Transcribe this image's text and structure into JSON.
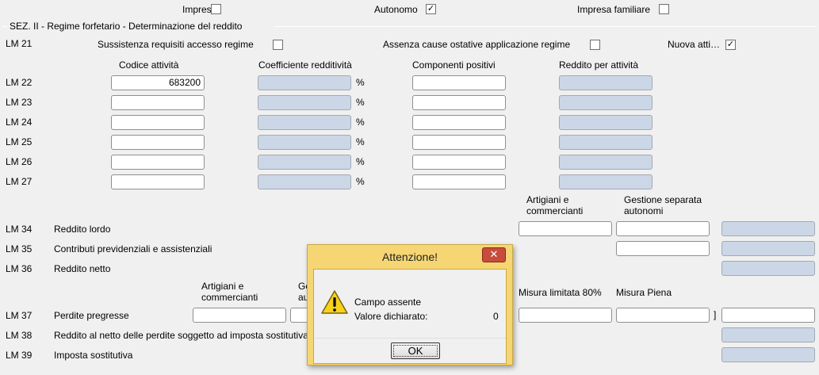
{
  "header": {
    "impresa_label": "Impresa",
    "impresa_checked": "",
    "autonomo_label": "Autonomo",
    "autonomo_checked": "✓",
    "impresa_familiare_label": "Impresa familiare",
    "impresa_familiare_checked": ""
  },
  "section": {
    "title": "SEZ. II - Regime forfetario - Determinazione del reddito"
  },
  "lm21": {
    "code": "LM 21",
    "sussistenza_label": "Sussistenza requisiti accesso regime",
    "sussistenza_checked": "",
    "assenza_label": "Assenza cause ostative applicazione regime",
    "assenza_checked": "",
    "nuova_label": "Nuova atti…",
    "nuova_checked": "✓"
  },
  "columns": {
    "codice": "Codice attività",
    "coefficiente": "Coefficiente redditività",
    "componenti": "Componenti positivi",
    "reddito": "Reddito per attività"
  },
  "percent_sign": "%",
  "activity_rows": [
    {
      "code": "LM 22",
      "codice_value": "683200"
    },
    {
      "code": "LM 23",
      "codice_value": ""
    },
    {
      "code": "LM 24",
      "codice_value": ""
    },
    {
      "code": "LM 25",
      "codice_value": ""
    },
    {
      "code": "LM 26",
      "codice_value": ""
    },
    {
      "code": "LM 27",
      "codice_value": ""
    }
  ],
  "lm34_header": {
    "artigiani_line1": "Artigiani e",
    "artigiani_line2": "commercianti",
    "gestione_line1": "Gestione separata",
    "gestione_line2": "autonomi"
  },
  "lm34": {
    "code": "LM 34",
    "label": "Reddito lordo"
  },
  "lm35": {
    "code": "LM 35",
    "label": "Contributi previdenziali e assistenziali"
  },
  "lm36": {
    "code": "LM 36",
    "label": "Reddito netto"
  },
  "lm37_header": {
    "artigiani_line1": "Artigiani e",
    "artigiani_line2": "commercianti",
    "gestione_line1": "Gestione separata",
    "gestione_line2": "autonomi",
    "misura_limitata": "Misura limitata 80%",
    "misura_piena": "Misura Piena"
  },
  "lm37": {
    "code": "LM 37",
    "label": "Perdite pregresse",
    "bracket": "]"
  },
  "lm38": {
    "code": "LM 38",
    "label": "Reddito al netto delle perdite soggetto ad imposta sostitutiva"
  },
  "lm39": {
    "code": "LM 39",
    "label": "Imposta sostitutiva"
  },
  "dialog": {
    "title": "Attenzione!",
    "close": "✕",
    "message": "Campo assente",
    "value_label": "Valore dichiarato:",
    "value": "0",
    "ok": "OK"
  },
  "colors": {
    "background": "#f0f0f0",
    "readonly_field": "#cbd7e6",
    "dialog_frame": "#f5d673",
    "close_button": "#c74c3c"
  }
}
